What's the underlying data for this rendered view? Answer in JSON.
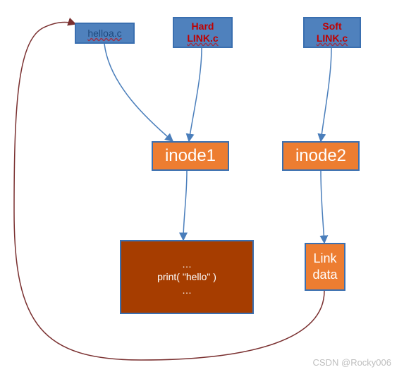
{
  "nodes": {
    "helloa": {
      "label": "helloa.c"
    },
    "hardlink": {
      "line1": "Hard",
      "line2": "LINK.c"
    },
    "softlink": {
      "line1": "Soft",
      "line2": "LINK.c"
    },
    "inode1": {
      "label": "inode1"
    },
    "inode2": {
      "label": "inode2"
    },
    "code": {
      "line1": "…",
      "line2": "print( \"hello\" )",
      "line3": "…"
    },
    "linkdata": {
      "line1": "Link",
      "line2": "data"
    }
  },
  "watermark": "CSDN @Rocky006",
  "colors": {
    "blue": "#4f81bd",
    "orange": "#ed7d31",
    "brown": "#a63d00",
    "arrowBlue": "#4a7ebb",
    "arrowDark": "#7a3030"
  }
}
